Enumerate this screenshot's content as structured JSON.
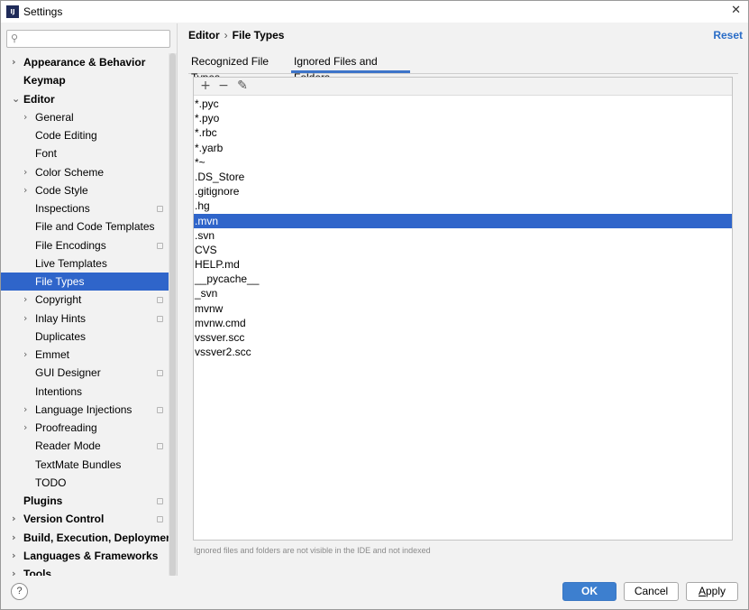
{
  "window": {
    "title": "Settings",
    "app_icon": "intellij-icon",
    "app_icon_text": "IJ"
  },
  "sidebar": {
    "search_placeholder": "",
    "items": [
      {
        "label": "Appearance & Behavior",
        "level": 0,
        "bold": true,
        "arrow": "›",
        "badge": false
      },
      {
        "label": "Keymap",
        "level": 0,
        "bold": true,
        "arrow": "",
        "badge": false
      },
      {
        "label": "Editor",
        "level": 0,
        "bold": true,
        "arrow": "⌄",
        "badge": false
      },
      {
        "label": "General",
        "level": 1,
        "bold": false,
        "arrow": "›",
        "badge": false
      },
      {
        "label": "Code Editing",
        "level": 1,
        "bold": false,
        "arrow": "",
        "badge": false
      },
      {
        "label": "Font",
        "level": 1,
        "bold": false,
        "arrow": "",
        "badge": false
      },
      {
        "label": "Color Scheme",
        "level": 1,
        "bold": false,
        "arrow": "›",
        "badge": false
      },
      {
        "label": "Code Style",
        "level": 1,
        "bold": false,
        "arrow": "›",
        "badge": false
      },
      {
        "label": "Inspections",
        "level": 1,
        "bold": false,
        "arrow": "",
        "badge": true
      },
      {
        "label": "File and Code Templates",
        "level": 1,
        "bold": false,
        "arrow": "",
        "badge": false
      },
      {
        "label": "File Encodings",
        "level": 1,
        "bold": false,
        "arrow": "",
        "badge": true
      },
      {
        "label": "Live Templates",
        "level": 1,
        "bold": false,
        "arrow": "",
        "badge": false
      },
      {
        "label": "File Types",
        "level": 1,
        "bold": false,
        "arrow": "",
        "badge": false,
        "selected": true
      },
      {
        "label": "Copyright",
        "level": 1,
        "bold": false,
        "arrow": "›",
        "badge": true
      },
      {
        "label": "Inlay Hints",
        "level": 1,
        "bold": false,
        "arrow": "›",
        "badge": true
      },
      {
        "label": "Duplicates",
        "level": 1,
        "bold": false,
        "arrow": "",
        "badge": false
      },
      {
        "label": "Emmet",
        "level": 1,
        "bold": false,
        "arrow": "›",
        "badge": false
      },
      {
        "label": "GUI Designer",
        "level": 1,
        "bold": false,
        "arrow": "",
        "badge": true
      },
      {
        "label": "Intentions",
        "level": 1,
        "bold": false,
        "arrow": "",
        "badge": false
      },
      {
        "label": "Language Injections",
        "level": 1,
        "bold": false,
        "arrow": "›",
        "badge": true
      },
      {
        "label": "Proofreading",
        "level": 1,
        "bold": false,
        "arrow": "›",
        "badge": false
      },
      {
        "label": "Reader Mode",
        "level": 1,
        "bold": false,
        "arrow": "",
        "badge": true
      },
      {
        "label": "TextMate Bundles",
        "level": 1,
        "bold": false,
        "arrow": "",
        "badge": false
      },
      {
        "label": "TODO",
        "level": 1,
        "bold": false,
        "arrow": "",
        "badge": false
      },
      {
        "label": "Plugins",
        "level": 0,
        "bold": true,
        "arrow": "",
        "badge": true
      },
      {
        "label": "Version Control",
        "level": 0,
        "bold": true,
        "arrow": "›",
        "badge": true
      },
      {
        "label": "Build, Execution, Deployment",
        "level": 0,
        "bold": true,
        "arrow": "›",
        "badge": false
      },
      {
        "label": "Languages & Frameworks",
        "level": 0,
        "bold": true,
        "arrow": "›",
        "badge": false
      },
      {
        "label": "Tools",
        "level": 0,
        "bold": true,
        "arrow": "›",
        "badge": false
      }
    ]
  },
  "main": {
    "breadcrumb": [
      "Editor",
      "File Types"
    ],
    "breadcrumb_separator": "›",
    "reset_label": "Reset",
    "tabs": [
      {
        "label": "Recognized File Types",
        "active": false
      },
      {
        "label": "Ignored Files and Folders",
        "active": true
      }
    ],
    "toolbar": {
      "add": "+",
      "remove": "−",
      "edit": "✎"
    },
    "ignored_items": [
      "*.pyc",
      "*.pyo",
      "*.rbc",
      "*.yarb",
      "*~",
      ".DS_Store",
      ".gitignore",
      ".hg",
      ".mvn",
      ".svn",
      "CVS",
      "HELP.md",
      "__pycache__",
      "_svn",
      "mvnw",
      "mvnw.cmd",
      "vssver.scc",
      "vssver2.scc"
    ],
    "selected_item": ".mvn",
    "hint": "Ignored files and folders are not visible in the IDE and not indexed"
  },
  "footer": {
    "help": "?",
    "ok": "OK",
    "cancel": "Cancel",
    "apply": "Apply"
  },
  "colors": {
    "selection": "#2f65ca",
    "accent": "#3d7fcf",
    "link": "#2a6dc7"
  }
}
